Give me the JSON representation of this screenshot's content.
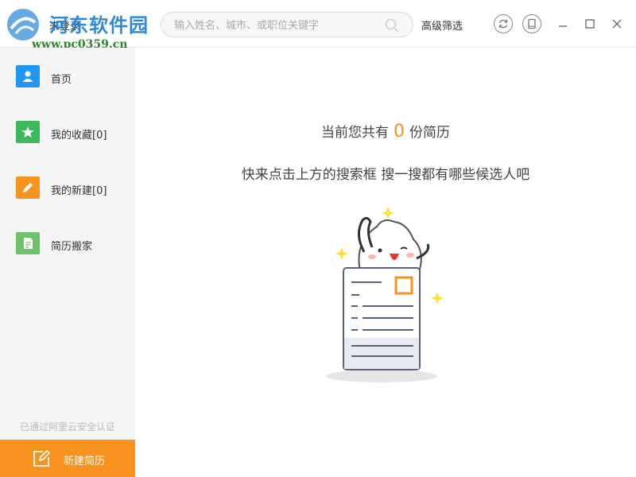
{
  "watermark": {
    "title": "河东软件园",
    "url": "www.pc0359.cn"
  },
  "header": {
    "login_label": "未登录",
    "search_placeholder": "输入姓名、城市、或职位关键字",
    "advanced_filter_label": "高级筛选",
    "icons": [
      "refresh-icon",
      "tablet-icon",
      "minimize-icon",
      "maximize-icon",
      "close-icon"
    ]
  },
  "sidebar": {
    "items": [
      {
        "label": "首页",
        "icon": "user-icon",
        "color": "#2196f3"
      },
      {
        "label": "我的收藏[0]",
        "icon": "star-icon",
        "color": "#3cb95c"
      },
      {
        "label": "我的新建[0]",
        "icon": "pencil-icon",
        "color": "#f7931e"
      },
      {
        "label": "简历搬家",
        "icon": "document-icon",
        "color": "#6cc26a"
      }
    ],
    "cert_text": "已通过阿里云安全认证",
    "new_resume_label": "新建简历"
  },
  "main": {
    "count_prefix": "当前您共有",
    "count_value": "0",
    "count_suffix": "份简历",
    "hint": "快来点击上方的搜索框 搜一搜都有哪些候选人吧"
  },
  "colors": {
    "accent": "#f7931e",
    "sidebar_bg": "#f5f5f5"
  }
}
